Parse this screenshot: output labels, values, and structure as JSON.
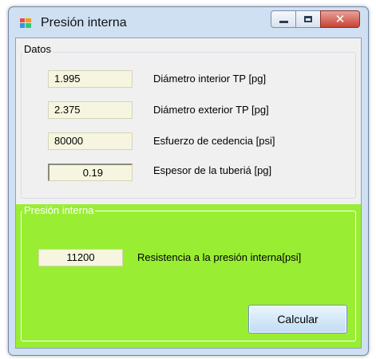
{
  "window": {
    "title": "Presión interna",
    "controls": {
      "minimize": "minimize",
      "maximize": "maximize",
      "close": "x"
    }
  },
  "datos": {
    "group_label": "Datos",
    "fields": [
      {
        "value": "1.995",
        "label": "Diámetro interior TP [pg]"
      },
      {
        "value": "2.375",
        "label": "Diámetro exterior TP [pg]"
      },
      {
        "value": "80000",
        "label": "Esfuerzo de cedencia [psi]"
      },
      {
        "value": "0.19",
        "label": "Espesor de la tuberiá [pg]"
      }
    ]
  },
  "presion": {
    "group_label": "Presión interna",
    "result_value": "11200",
    "result_label": "Resistencia a la presión interna[psi]",
    "calc_button": "Calcular"
  },
  "colors": {
    "panel_green": "#99ee33",
    "field_bg": "#f6f6e0",
    "close_red": "#c74234"
  }
}
